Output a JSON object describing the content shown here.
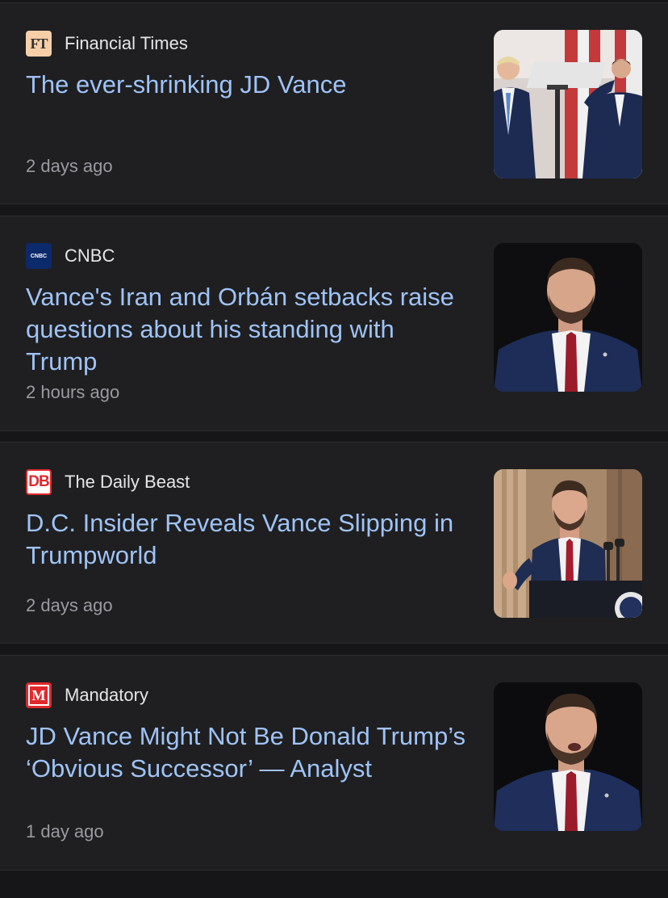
{
  "articles": [
    {
      "source": "Financial Times",
      "logo_icon": "financial-times-logo",
      "logo_text": "FT",
      "headline": "The ever-shrinking JD Vance",
      "time": "2 days ago",
      "thumbnail": "photo of two men at a podium with flags",
      "accent": "#f6cfa9"
    },
    {
      "source": "CNBC",
      "logo_icon": "cnbc-logo",
      "logo_text": "CNBC",
      "headline": "Vance's Iran and Orbán setbacks raise questions about his standing with Trump",
      "time": "2 hours ago",
      "thumbnail": "portrait photo of man in suit with red tie",
      "accent": "#0c2a6b"
    },
    {
      "source": "The Daily Beast",
      "logo_icon": "daily-beast-logo",
      "logo_text": "DB",
      "headline": "D.C. Insider Reveals Vance Slipping in Trumpworld",
      "time": "2 days ago",
      "thumbnail": "photo of man speaking at a lectern",
      "accent": "#e0282c"
    },
    {
      "source": "Mandatory",
      "logo_icon": "mandatory-logo",
      "logo_text": "M",
      "headline": "JD Vance Might Not Be Donald Trump’s ‘Obvious Successor’ — Analyst",
      "time": "1 day ago",
      "thumbnail": "portrait photo of man in suit speaking",
      "accent": "#e0282c"
    }
  ],
  "colors": {
    "background": "#161618",
    "card": "#1f1f21",
    "headline": "#9fc3f6",
    "source": "#e6e6e8",
    "time": "#9a9aa0"
  }
}
